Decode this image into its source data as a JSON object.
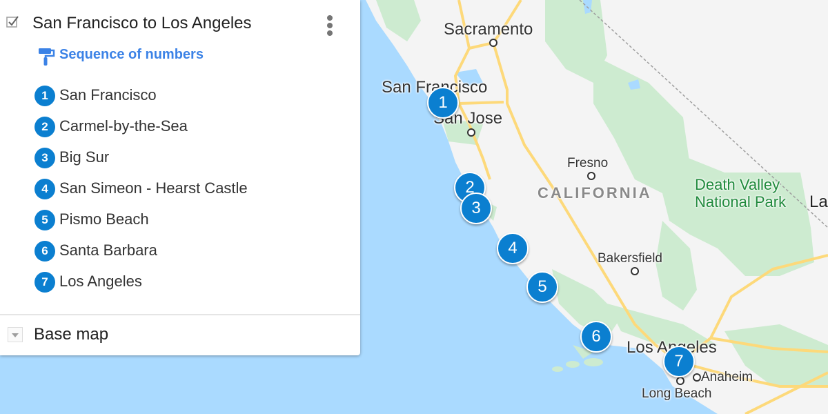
{
  "map": {
    "colors": {
      "water": "#aadaff",
      "land": "#f4f4f4",
      "park": "#cdebd0",
      "highway": "#fdd97a",
      "marker": "#0b7fd0",
      "accent": "#3b82e6"
    },
    "labels": {
      "sacramento": "Sacramento",
      "san_francisco": "San Francisco",
      "san_jose": "San Jose",
      "fresno": "Fresno",
      "california": "CALIFORNIA",
      "death_valley_line1": "Death Valley",
      "death_valley_line2": "National Park",
      "las_vegas_partial": "La",
      "bakersfield": "Bakersfield",
      "los_angeles": "Los Angeles",
      "anaheim": "Anaheim",
      "long_beach": "Long Beach"
    },
    "markers": [
      "1",
      "2",
      "3",
      "4",
      "5",
      "6",
      "7"
    ]
  },
  "panel": {
    "layer_title": "San Francisco to Los Angeles",
    "layer_checked": true,
    "style_label": "Sequence of numbers",
    "places": [
      {
        "num": "1",
        "name": "San Francisco"
      },
      {
        "num": "2",
        "name": "Carmel-by-the-Sea"
      },
      {
        "num": "3",
        "name": "Big Sur"
      },
      {
        "num": "4",
        "name": "San Simeon - Hearst Castle"
      },
      {
        "num": "5",
        "name": "Pismo Beach"
      },
      {
        "num": "6",
        "name": "Santa Barbara"
      },
      {
        "num": "7",
        "name": "Los Angeles"
      }
    ],
    "base_map_label": "Base map"
  }
}
